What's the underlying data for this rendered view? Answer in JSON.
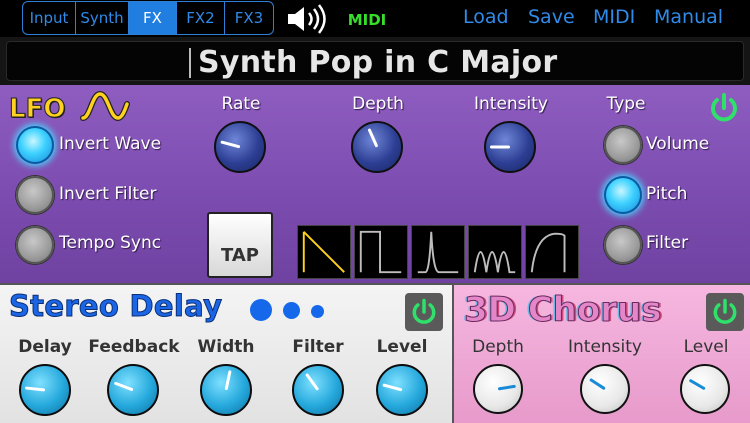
{
  "topbar": {
    "tabs": [
      {
        "label": "Input",
        "active": false
      },
      {
        "label": "Synth",
        "active": false
      },
      {
        "label": "FX",
        "active": true
      },
      {
        "label": "FX2",
        "active": false
      },
      {
        "label": "FX3",
        "active": false
      }
    ],
    "midi_logo": "MIDI",
    "menu": {
      "load": "Load",
      "save": "Save",
      "midi": "MIDI",
      "manual": "Manual"
    }
  },
  "preset": {
    "name": "Synth Pop in C Major"
  },
  "lfo": {
    "title": "LFO",
    "options": [
      {
        "label": "Invert Wave",
        "on": true
      },
      {
        "label": "Invert Filter",
        "on": false
      },
      {
        "label": "Tempo Sync",
        "on": false
      }
    ],
    "knobs": [
      {
        "label": "Rate",
        "value": 0.25
      },
      {
        "label": "Depth",
        "value": 0.42
      },
      {
        "label": "Intensity",
        "value": 0.2
      }
    ],
    "tap_label": "TAP",
    "waveforms": [
      "saw-down",
      "square",
      "spike",
      "triple-hump",
      "ramp-up"
    ],
    "selected_waveform": 0,
    "type_title": "Type",
    "types": [
      {
        "label": "Volume",
        "on": false
      },
      {
        "label": "Pitch",
        "on": true
      },
      {
        "label": "Filter",
        "on": false
      }
    ],
    "power_on": true
  },
  "delay": {
    "title": "Stereo Delay",
    "knobs": [
      {
        "label": "Delay",
        "value": 0.22
      },
      {
        "label": "Feedback",
        "value": 0.27
      },
      {
        "label": "Width",
        "value": 0.54
      },
      {
        "label": "Filter",
        "value": 0.38
      },
      {
        "label": "Level",
        "value": 0.25
      }
    ],
    "power_on": true
  },
  "chorus": {
    "title": "3D Chorus",
    "knobs": [
      {
        "label": "Depth",
        "value": 0.77
      },
      {
        "label": "Intensity",
        "value": 0.31
      },
      {
        "label": "Level",
        "value": 0.3
      }
    ],
    "power_on": true
  },
  "colors": {
    "accent_blue": "#2f8ae8",
    "power_green": "#2fe06a",
    "lfo_yellow": "#ffd21f",
    "delay_blue": "#1b66e6",
    "chorus_pink": "#e487c8"
  }
}
